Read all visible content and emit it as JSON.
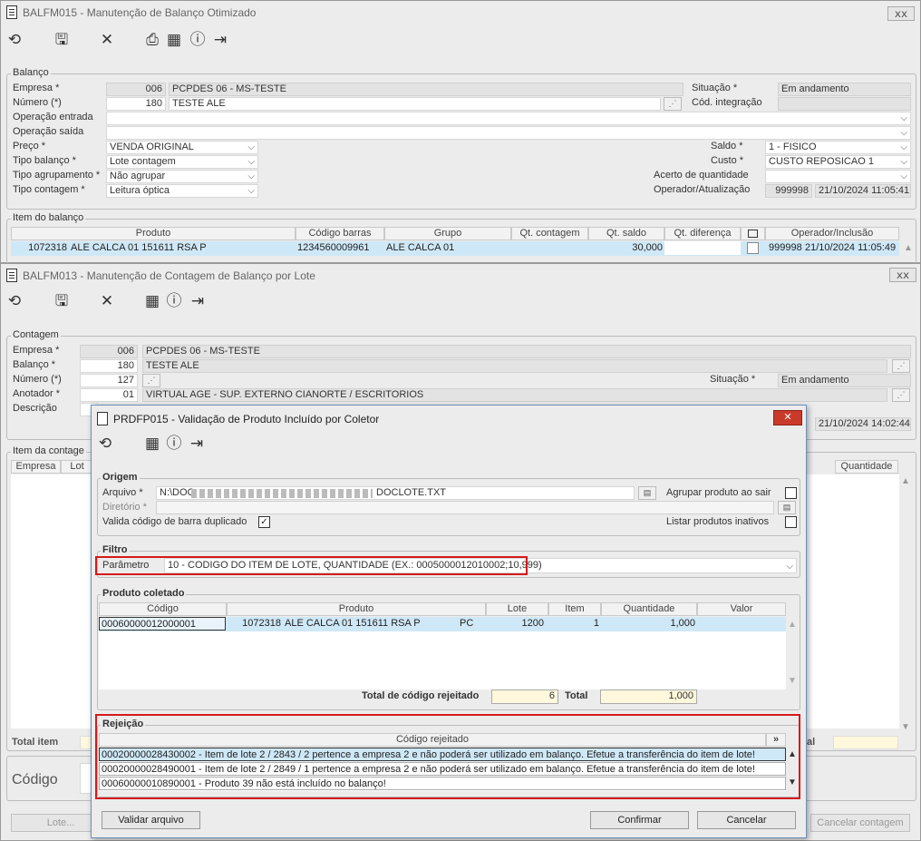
{
  "w1": {
    "title": "BALFM015 - Manutenção de Balanço Otimizado",
    "close": "ⅹⅹ",
    "group_balanco": "Balanço",
    "empresa_label": "Empresa *",
    "empresa_code": "006",
    "empresa_name": "PCPDES 06 - MS-TESTE",
    "numero_label": "Número (*)",
    "numero_value": "180",
    "numero_desc": "TESTE ALE",
    "op_entrada_label": "Operação entrada",
    "op_saida_label": "Operação saída",
    "preco_label": "Preço *",
    "preco_value": "VENDA ORIGINAL",
    "tipo_balanco_label": "Tipo balanço *",
    "tipo_balanco_value": "Lote contagem",
    "tipo_agrup_label": "Tipo agrupamento *",
    "tipo_agrup_value": "Não agrupar",
    "tipo_contagem_label": "Tipo contagem *",
    "tipo_contagem_value": "Leitura óptica",
    "situacao_label": "Situação *",
    "situacao_value": "Em andamento",
    "cod_integ_label": "Cód. integração",
    "saldo_label": "Saldo *",
    "saldo_value": "1 - FISICO",
    "custo_label": "Custo *",
    "custo_value": "CUSTO REPOSICAO 1",
    "acerto_label": "Acerto de quantidade",
    "operador_label": "Operador/Atualização",
    "operador_value": "999998",
    "operador_dt": "21/10/2024 11:05:41",
    "group_item": "Item do balanço",
    "cols": [
      "Produto",
      "Código barras",
      "Grupo",
      "Qt. contagem",
      "Qt. saldo",
      "Qt. diferença",
      "Operador/Inclusão"
    ],
    "row": {
      "cod": "1072318",
      "produto": "ALE CALCA 01 151611 RSA P",
      "barras": "1234560009961",
      "grupo": "ALE CALCA 01",
      "qt_contagem": "",
      "qt_saldo": "30,000",
      "qt_dif": "",
      "oper": "999998",
      "dt": "21/10/2024 11:05:49"
    }
  },
  "w2": {
    "title": "BALFM013 - Manutenção de Contagem de Balanço por Lote",
    "group_contagem": "Contagem",
    "empresa_label": "Empresa *",
    "empresa_code": "006",
    "empresa_name": "PCPDES 06 - MS-TESTE",
    "balanco_label": "Balanço *",
    "balanco_value": "180",
    "balanco_desc": "TESTE ALE",
    "numero_label": "Número (*)",
    "numero_value": "127",
    "situacao_label": "Situação *",
    "situacao_value": "Em andamento",
    "anotador_label": "Anotador *",
    "anotador_value": "01",
    "anotador_desc": "VIRTUAL AGE - SUP. EXTERNO CIANORTE / ESCRITORIOS",
    "descricao_label": "Descrição",
    "dt_value": "21/10/2024 14:02:44",
    "group_item": "Item da contage",
    "col_empresa": "Empresa",
    "col_lote": "Lot",
    "col_quantidade": "Quantidade",
    "total_item_label": "Total item",
    "codigo_label": "Código",
    "total_right": "al",
    "lote_btn": "Lote...",
    "cancelar_btn": "Cancelar contagem"
  },
  "dlg": {
    "title": "PRDFP015 - Validação de Produto Incluído por Coletor",
    "close": "✕",
    "group_origem": "Origem",
    "arquivo_label": "Arquivo *",
    "arquivo_value": "N:\\DOC",
    "arquivo_value_end": "DOCLOTE.TXT",
    "diretorio_label": "Diretório *",
    "valida_label": "Valida código de barra duplicado",
    "agrupar_label": "Agrupar produto ao sair",
    "listar_label": "Listar produtos inativos",
    "group_filtro": "Filtro",
    "parametro_label": "Parâmetro",
    "parametro_value": "10 - CODIGO DO ITEM DE LOTE, QUANTIDADE (EX.: 0005000012010002;10,999)",
    "group_produto": "Produto coletado",
    "cols": [
      "Código",
      "Produto",
      "Lote",
      "Item",
      "Quantidade",
      "Valor"
    ],
    "row": {
      "codigo": "00060000012000001",
      "cod": "1072318",
      "produto": "ALE CALCA 01 151611 RSA P",
      "un": "PC",
      "lote": "1200",
      "item": "1",
      "quantidade": "1,000",
      "valor": ""
    },
    "total_rej_label": "Total de código rejeitado",
    "total_rej_value": "6",
    "total_label": "Total",
    "total_value": "1,000",
    "group_rejeicao": "Rejeição",
    "rej_header": "Código rejeitado",
    "rej_rows": [
      "00020000028430002 - Item de lote 2 / 2843 / 2 pertence a empresa 2 e não poderá ser utilizado em balanço. Efetue a transferência do item de lote!",
      "00020000028490001 - Item de lote 2 / 2849 / 1 pertence a empresa 2 e não poderá ser utilizado em balanço. Efetue a transferência do item de lote!",
      "00060000010890001 - Produto 39 não está incluído no balanço!"
    ],
    "validar_btn": "Validar arquivo",
    "confirmar_btn": "Confirmar",
    "cancelar_btn": "Cancelar"
  }
}
